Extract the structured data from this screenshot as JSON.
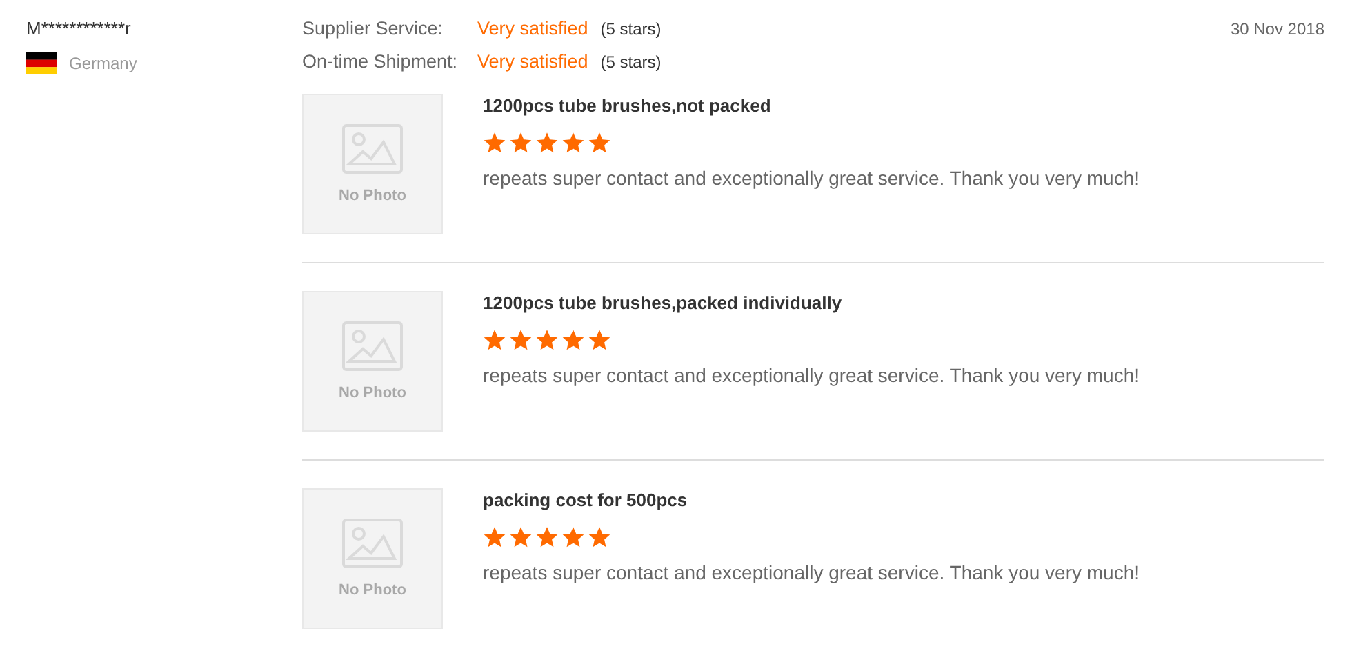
{
  "reviewer": {
    "name": "M************r",
    "country": "Germany"
  },
  "ratings": [
    {
      "label": "Supplier Service:",
      "value": "Very satisfied",
      "detail": "(5 stars)"
    },
    {
      "label": "On-time Shipment:",
      "value": "Very satisfied",
      "detail": "(5 stars)"
    }
  ],
  "date": "30 Nov 2018",
  "items": [
    {
      "photo_text": "No Photo",
      "title": "1200pcs tube brushes,not packed",
      "stars": 5,
      "comment": "repeats super contact and exceptionally great service. Thank you very much!"
    },
    {
      "photo_text": "No Photo",
      "title": "1200pcs tube brushes,packed individually",
      "stars": 5,
      "comment": "repeats super contact and exceptionally great service. Thank you very much!"
    },
    {
      "photo_text": "No Photo",
      "title": "packing cost for 500pcs",
      "stars": 5,
      "comment": "repeats super contact and exceptionally great service. Thank you very much!"
    }
  ]
}
